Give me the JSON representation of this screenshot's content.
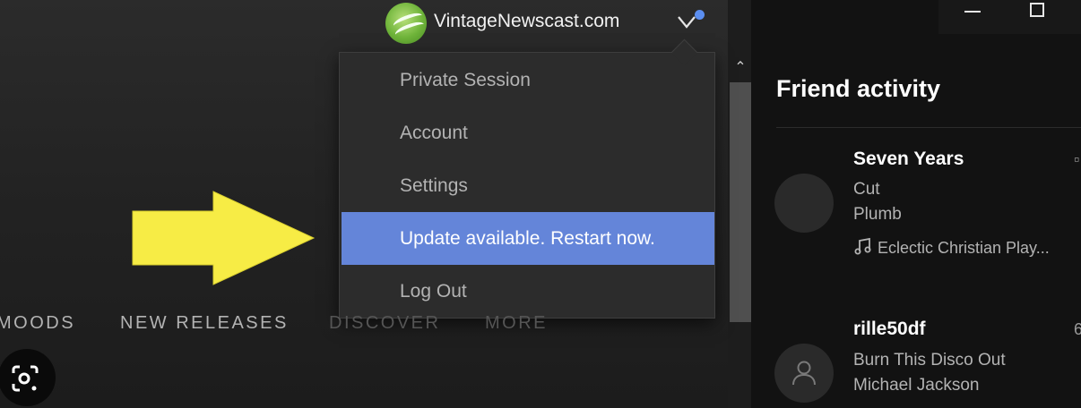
{
  "header": {
    "username": "VintageNewscast.com",
    "avatar_icon": "globe-logo-icon",
    "chevron_icon": "chevron-down-icon",
    "notification_color": "#5b8ef0"
  },
  "menu": {
    "items": [
      {
        "label": "Private Session"
      },
      {
        "label": "Account"
      },
      {
        "label": "Settings"
      },
      {
        "label": "Update available. Restart now.",
        "highlighted": true
      },
      {
        "label": "Log Out"
      }
    ],
    "highlight_color": "#6485d9"
  },
  "nav": {
    "tabs": [
      {
        "label": "MOODS"
      },
      {
        "label": "NEW RELEASES"
      },
      {
        "label": "DISCOVER"
      },
      {
        "label": "MORE"
      }
    ]
  },
  "annotation": {
    "arrow_color": "#f7ec45",
    "arrow_icon": "arrow-right-icon"
  },
  "window": {
    "minimize_icon": "minimize-icon",
    "maximize_icon": "maximize-icon"
  },
  "friend_activity": {
    "title": "Friend activity",
    "friends": [
      {
        "track": "Seven Years",
        "artist_line": "Cut",
        "sub_line": "Plumb",
        "context": "Eclectic Christian Play...",
        "context_icon": "music-note-icon",
        "edge_text": "▫"
      },
      {
        "track": "rille50df",
        "artist_line": "Burn This Disco Out",
        "sub_line": "Michael Jackson",
        "avatar_icon": "user-icon",
        "edge_text": "6"
      }
    ]
  },
  "overlay": {
    "lens_icon": "google-lens-icon"
  }
}
